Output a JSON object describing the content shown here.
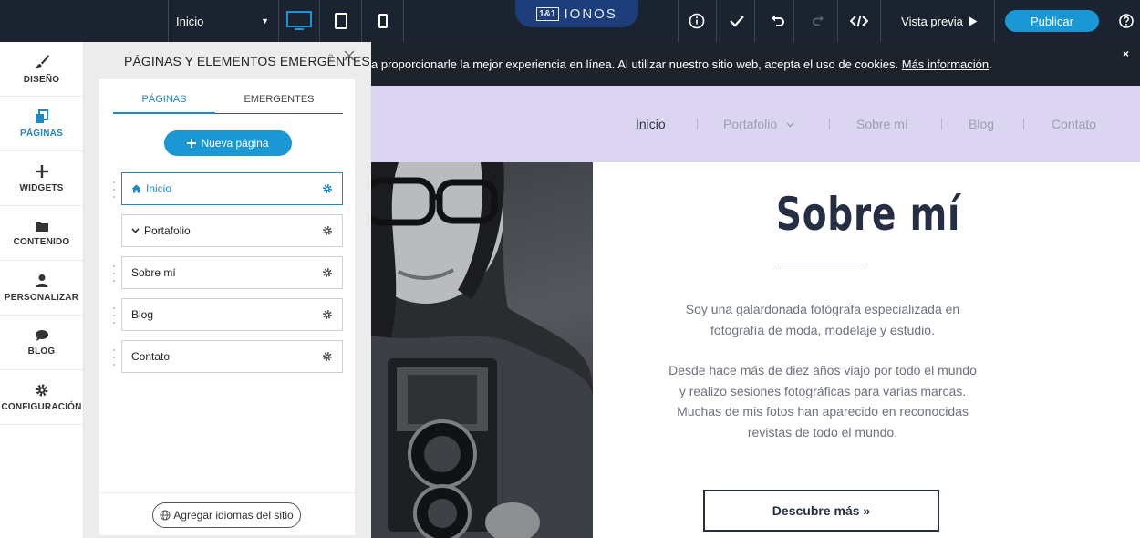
{
  "topbar": {
    "page_select": "Inicio",
    "brand_box": "1&1",
    "brand_name": "IONOS",
    "preview_label": "Vista previa",
    "publish_label": "Publicar"
  },
  "sidebar": {
    "items": [
      {
        "label": "DISEÑO",
        "icon": "brush-icon"
      },
      {
        "label": "PÁGINAS",
        "icon": "pages-icon"
      },
      {
        "label": "WIDGETS",
        "icon": "plus-icon"
      },
      {
        "label": "CONTENIDO",
        "icon": "folder-icon"
      },
      {
        "label": "PERSONALIZAR",
        "icon": "user-icon"
      },
      {
        "label": "BLOG",
        "icon": "chat-icon"
      },
      {
        "label": "CONFIGURACIÓN",
        "icon": "gear-icon"
      }
    ]
  },
  "panel": {
    "title": "PÁGINAS Y ELEMENTOS EMERGENTES",
    "help_mark": "?",
    "tabs": [
      "PÁGINAS",
      "EMERGENTES"
    ],
    "new_page": "Nueva página",
    "pages": [
      "Inicio",
      "Portafolio",
      "Sobre mí",
      "Blog",
      "Contato"
    ],
    "add_languages": "Agregar idiomas del sitio"
  },
  "site": {
    "cookie_text": "a proporcionarle la mejor experiencia en línea. Al utilizar nuestro sitio web, acepta el uso de cookies.",
    "cookie_link": "Más información",
    "cookie_close": "×",
    "nav": [
      "Inicio",
      "Portafolio",
      "Sobre mí",
      "Blog",
      "Contato"
    ],
    "heading": "Sobre mí",
    "para1": "Soy una galardonada fotógrafa especializada en fotografía de moda, modelaje y estudio.",
    "para2": "Desde hace más de diez años viajo por todo el mundo y realizo sesiones fotográficas para varias marcas. Muchas de mis fotos han aparecido en reconocidas revistas de todo el mundo.",
    "cta": "Descubre más »"
  },
  "colors": {
    "accent": "#1a98d5",
    "topbar": "#1c2330",
    "nav_bg": "#dcd5f2",
    "heading": "#262e44"
  }
}
